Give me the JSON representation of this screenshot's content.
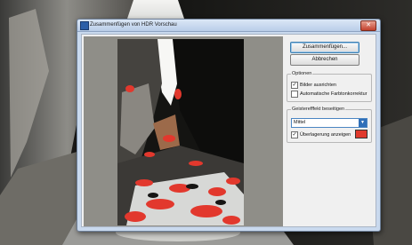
{
  "dialog": {
    "title": "Zusammenfügen von HDR Vorschau",
    "close_glyph": "✕"
  },
  "buttons": {
    "merge": "Zusammenfügen...",
    "cancel": "Abbrechen"
  },
  "options": {
    "label": "Optionen",
    "items": [
      {
        "label": "Bilder ausrichten",
        "checked": true
      },
      {
        "label": "Automatische Farbtonkorrektur",
        "checked": false
      }
    ]
  },
  "ghosting": {
    "label": "Geisterefffekt beseitigen",
    "select_value": "Mittel",
    "overlay_label": "Überlagerung anzeigen",
    "overlay_checked": true,
    "overlay_color": "#e0392c"
  },
  "check_mark": "✓",
  "colors": {
    "window_frame": "#c9d9ee",
    "preview_bg": "#8f8e88",
    "accent": "#2f6fb8"
  }
}
